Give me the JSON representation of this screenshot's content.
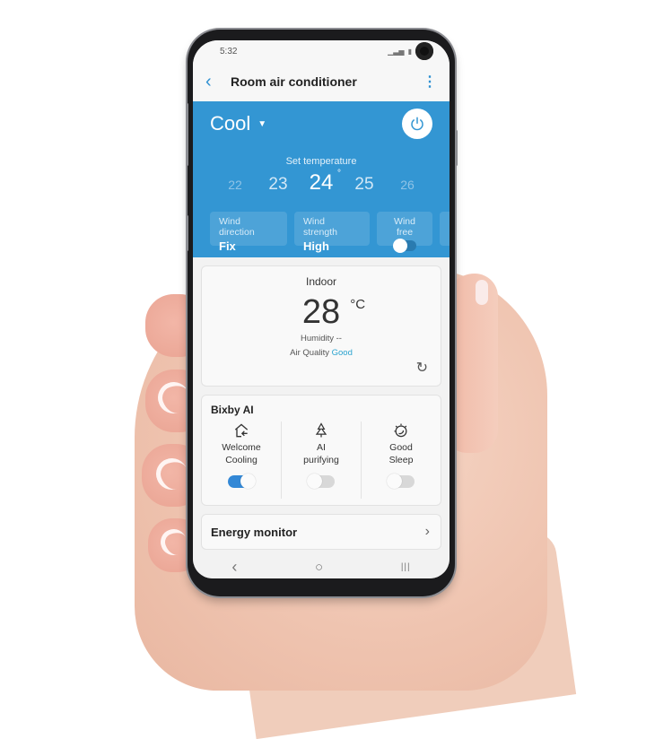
{
  "status_bar": {
    "time": "5:32",
    "signal_icon": "signal-icon",
    "battery_icon": "battery-icon"
  },
  "app_bar": {
    "back_icon": "chevron-left-icon",
    "title": "Room air conditioner",
    "more_icon": "more-vertical-icon"
  },
  "hero": {
    "mode": "Cool",
    "mode_caret": "▼",
    "power_icon": "power-icon",
    "set_temp_label": "Set temperature",
    "temperatures": [
      "22",
      "23",
      "24",
      "25",
      "26"
    ],
    "selected_temperature": "24",
    "degree_symbol": "°",
    "chips": [
      {
        "label": "Wind direction",
        "value": "Fix"
      },
      {
        "label": "Wind strength",
        "value": "High"
      },
      {
        "label": "Wind free",
        "toggle_on": false
      }
    ],
    "colors": {
      "background": "#3396d3"
    }
  },
  "indoor": {
    "title": "Indoor",
    "temperature": "28",
    "unit": "°C",
    "humidity": "Humidity --",
    "air_quality_label": "Air Quality",
    "air_quality_value": "Good",
    "refresh_icon": "refresh-icon"
  },
  "bixby": {
    "title": "Bixby AI",
    "features": [
      {
        "line1": "Welcome",
        "line2": "Cooling",
        "icon": "home-enter-icon",
        "on": true
      },
      {
        "line1": "AI",
        "line2": "purifying",
        "icon": "tree-icon",
        "on": false
      },
      {
        "line1": "Good",
        "line2": "Sleep",
        "icon": "sleep-icon",
        "on": false
      }
    ]
  },
  "energy": {
    "title": "Energy monitor",
    "chevron": "›"
  },
  "nav": {
    "back": "‹",
    "home": "○",
    "recents": "|||"
  }
}
